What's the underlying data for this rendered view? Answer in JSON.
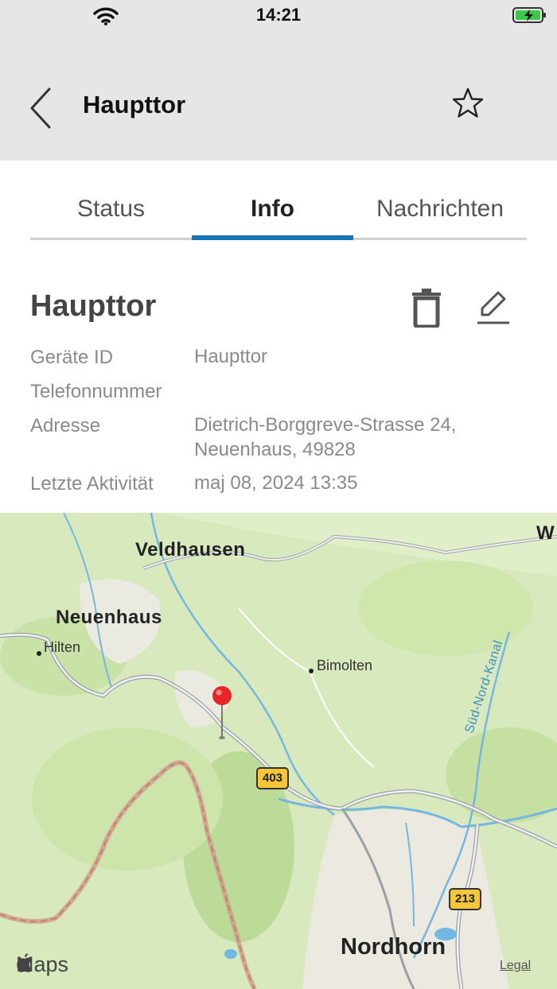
{
  "status_bar": {
    "time": "14:21"
  },
  "header": {
    "title": "Haupttor"
  },
  "tabs": [
    {
      "label": "Status"
    },
    {
      "label": "Info"
    },
    {
      "label": "Nachrichten"
    }
  ],
  "device": {
    "name": "Haupttor",
    "fields": [
      {
        "label": "Geräte ID",
        "value": "Haupttor"
      },
      {
        "label": "Telefonnummer",
        "value": ""
      },
      {
        "label": "Adresse",
        "value_line1": "Dietrich-Borggreve-Strasse 24,",
        "value_line2": "Neuenhaus, 49828"
      },
      {
        "label": "Letzte Aktivität",
        "value": "maj 08, 2024 13:35"
      }
    ]
  },
  "map": {
    "places": {
      "veldhausen": "Veldhausen",
      "neuenhaus": "Neuenhaus",
      "hilten": "Hilten",
      "bimolten": "Bimolten",
      "nordhorn": "Nordhorn",
      "w_edge": "W"
    },
    "roads": {
      "b403": "403",
      "b213": "213"
    },
    "canal": "Süd-Nord-Kanal",
    "logo": "Maps",
    "legal": "Legal"
  },
  "colors": {
    "accent": "#1874b4",
    "pin": "#e8262a"
  },
  "icons": [
    "wifi-icon",
    "battery-charging-icon",
    "back-chevron-icon",
    "star-icon",
    "trash-icon",
    "edit-icon",
    "map-pin-icon",
    "apple-logo-icon"
  ]
}
